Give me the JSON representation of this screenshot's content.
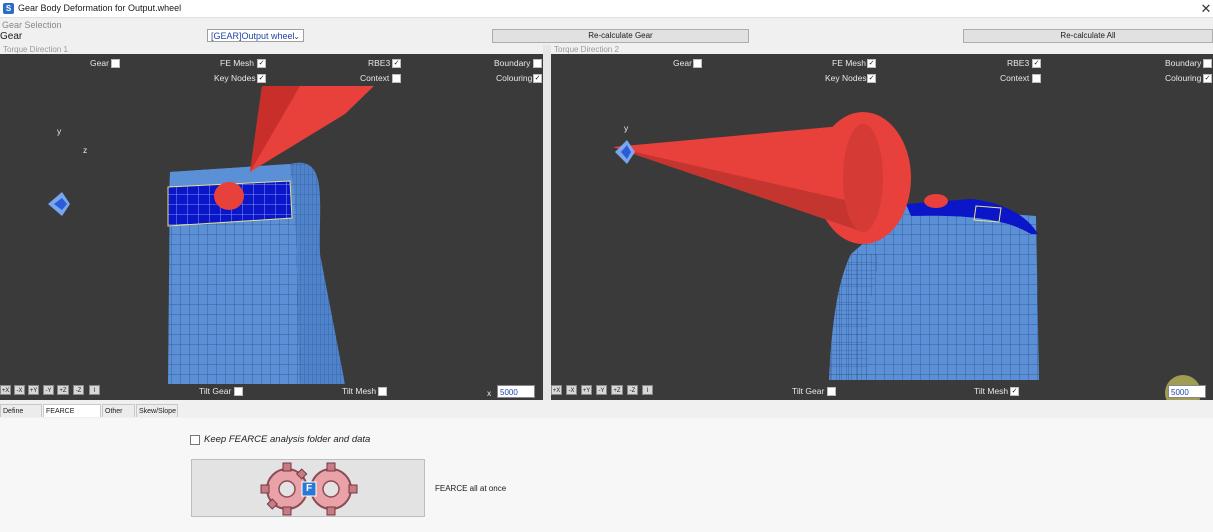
{
  "window": {
    "title": "Gear Body Deformation for Output.wheel",
    "icon_letter": "S"
  },
  "gear_selection": {
    "section_label": "Gear Selection",
    "gear_label": "Gear",
    "selected_gear": "[GEAR]Output wheel",
    "recalc_gear_label": "Re-calculate Gear",
    "recalc_all_label": "Re-calculate All"
  },
  "viewport1": {
    "caption": "Torque Direction 1",
    "options": {
      "gear": {
        "label": "Gear",
        "checked": false
      },
      "fe_mesh": {
        "label": "FE Mesh",
        "checked": true
      },
      "rbe3": {
        "label": "RBE3",
        "checked": true
      },
      "boundary": {
        "label": "Boundary",
        "checked": false
      },
      "key_nodes": {
        "label": "Key Nodes",
        "checked": true
      },
      "context": {
        "label": "Context",
        "checked": false
      },
      "colouring": {
        "label": "Colouring",
        "checked": true
      }
    },
    "tilt_gear": {
      "label": "Tilt Gear",
      "checked": false
    },
    "tilt_mesh": {
      "label": "Tilt Mesh",
      "checked": false
    },
    "axis_labels": {
      "y": "y",
      "z": "z"
    },
    "scale_label": "x",
    "scale_value": "5000"
  },
  "viewport2": {
    "caption": "Torque Direction 2",
    "options": {
      "gear": {
        "label": "Gear",
        "checked": false
      },
      "fe_mesh": {
        "label": "FE Mesh",
        "checked": true
      },
      "rbe3": {
        "label": "RBE3",
        "checked": true
      },
      "boundary": {
        "label": "Boundary",
        "checked": false
      },
      "key_nodes": {
        "label": "Key Nodes",
        "checked": true
      },
      "context": {
        "label": "Context",
        "checked": false
      },
      "colouring": {
        "label": "Colouring",
        "checked": true
      }
    },
    "tilt_gear": {
      "label": "Tilt Gear",
      "checked": false
    },
    "tilt_mesh": {
      "label": "Tilt Mesh",
      "checked": true
    },
    "axis_labels": {
      "y": "y"
    },
    "scale_value": "5000"
  },
  "view_buttons": [
    "+X",
    "-X",
    "+Y",
    "-Y",
    "+Z",
    "-Z",
    "I"
  ],
  "tabs": [
    "Define Mesh",
    "FEARCE Analysis",
    "Other FE",
    "Skew/Slope"
  ],
  "active_tab": "FEARCE Analysis",
  "fearce": {
    "keep_folder_label": "Keep FEARCE analysis folder and data",
    "keep_folder_checked": false,
    "run_all_label": "FEARCE all at once",
    "logo_letter": "F"
  },
  "colors": {
    "viewport_bg": "#3a3a3a",
    "mesh_light_blue": "#5b8fd6",
    "mesh_dark_blue": "#0b16c8",
    "cone_red": "#e8403a"
  }
}
